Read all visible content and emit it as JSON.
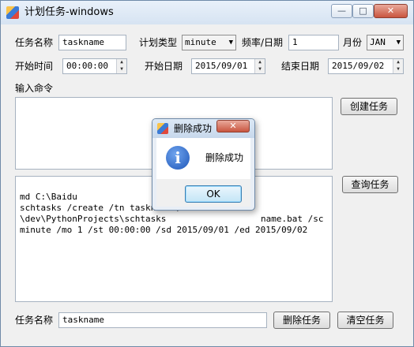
{
  "window": {
    "title": "计划任务-windows"
  },
  "row1": {
    "task_name_label": "任务名称",
    "task_name_value": "taskname",
    "plan_type_label": "计划类型",
    "plan_type_value": "minute",
    "freq_label": "频率/日期",
    "freq_value": "1",
    "month_label": "月份",
    "month_value": "JAN"
  },
  "row2": {
    "start_time_label": "开始时间",
    "start_time_value": "00:00:00",
    "start_date_label": "开始日期",
    "start_date_value": "2015/09/01",
    "end_date_label": "结束日期",
    "end_date_value": "2015/09/02"
  },
  "command": {
    "label": "输入命令",
    "value": ""
  },
  "buttons": {
    "create": "创建任务",
    "query": "查询任务",
    "delete": "删除任务",
    "clear": "清空任务"
  },
  "output": {
    "lines": [
      "md C:\\Baidu",
      "schtasks /create /tn taskname /tr ",
      "\\dev\\PythonProjects\\schtasks",
      "minute /mo 1 /st 00:00:00 /sd 2015/09/01 /ed 2015/09/02"
    ],
    "line3_tail": "name.bat /sc"
  },
  "bottom": {
    "task_name_label": "任务名称",
    "task_name_value": "taskname"
  },
  "dialog": {
    "title": "删除成功",
    "message": "删除成功",
    "ok": "OK"
  },
  "icons": {
    "app": "app-icon",
    "info": "info-icon"
  },
  "colors": {
    "accent": "#3c7fb1",
    "close": "#c9553f",
    "info": "#1e56b8"
  }
}
